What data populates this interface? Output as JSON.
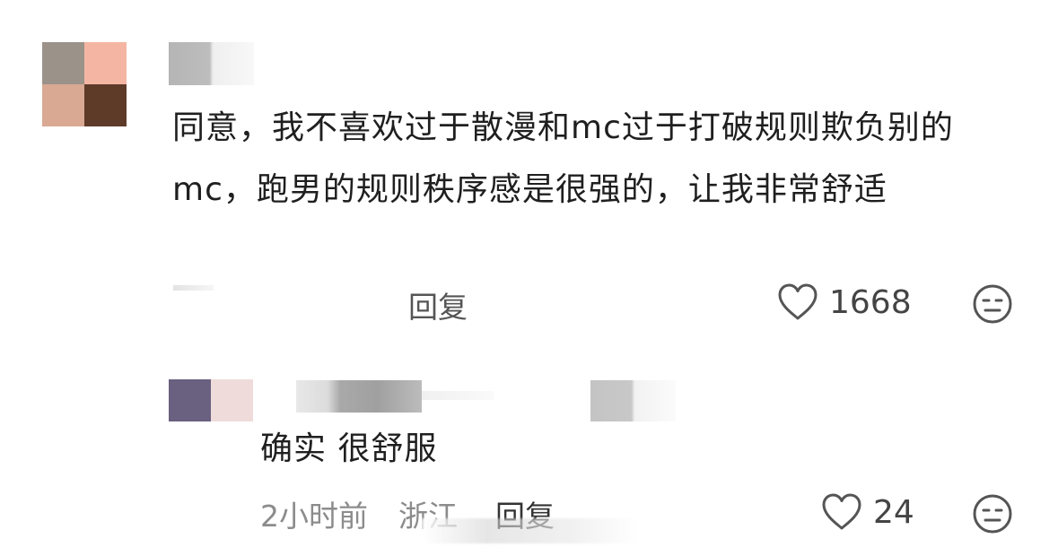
{
  "comment": {
    "text": "同意，我不喜欢过于散漫和mc过于打破规则欺负别的mc，跑男的规则秩序感是很强的，让我非常舒适",
    "reply_label": "回复",
    "like_count": "1668"
  },
  "reply": {
    "text": "确实 很舒服",
    "time": "2小时前",
    "location": "浙江",
    "reply_label": "回复",
    "like_count": "24"
  },
  "colors": {
    "avatar1": [
      "#9b928a",
      "#f4b6a2",
      "#d9a994",
      "#5e3a29"
    ],
    "avatar2": [
      "#6a6080",
      "#efdcda"
    ],
    "text": "#1f1f1f",
    "meta": "#8c8c8c"
  },
  "icons": {
    "like": "heart-outline-icon",
    "emoji": "neutral-face-icon"
  }
}
